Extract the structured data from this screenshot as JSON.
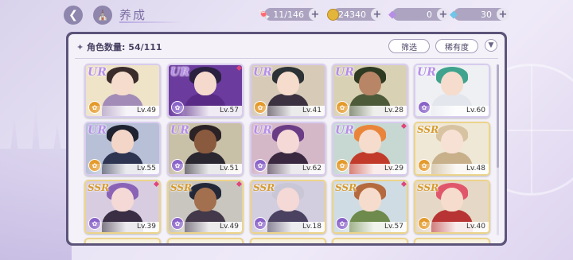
{
  "header": {
    "title": "养成",
    "resources": [
      {
        "name": "stamina",
        "icon": "candy-icon",
        "value": "11/146",
        "color": "#e2536b"
      },
      {
        "name": "gold",
        "icon": "coin-icon",
        "value": "24340",
        "color": "#e3b53b"
      },
      {
        "name": "diamond",
        "icon": "diamond-icon",
        "value": "0",
        "color": "#b78de6"
      },
      {
        "name": "crystal",
        "icon": "crystal-icon",
        "value": "30",
        "color": "#6fc6e8"
      }
    ]
  },
  "panel": {
    "count_label": "角色数量:",
    "count_value": "54/111",
    "filter_label": "筛选",
    "rarity_label": "稀有度"
  },
  "cards": [
    {
      "rarity": "UR",
      "level": "Lv.49",
      "attr_color": "#e49a2b",
      "hair": "#3b2c2c",
      "face": "#f6dccc",
      "body": "#a28bb6",
      "bg": "#efe3c8",
      "new": false
    },
    {
      "rarity": "UR",
      "level": "Lv.57",
      "attr_color": "#8a63c8",
      "hair": "#2a2140",
      "face": "#f4d9cc",
      "body": "#5a2b86",
      "bg": "#6b3b9e",
      "new": true
    },
    {
      "rarity": "UR",
      "level": "Lv.41",
      "attr_color": "#e49a2b",
      "hair": "#2c3236",
      "face": "#f6dccc",
      "body": "#3b3140",
      "bg": "#d7cbb8",
      "new": false
    },
    {
      "rarity": "UR",
      "level": "Lv.28",
      "attr_color": "#e49a2b",
      "hair": "#2e3a22",
      "face": "#b88566",
      "body": "#4d5a3a",
      "bg": "#d9d1b4",
      "new": false
    },
    {
      "rarity": "UR",
      "level": "Lv.60",
      "attr_color": "#8a63c8",
      "hair": "#3fa38d",
      "face": "#f6dccc",
      "body": "#e3e6ec",
      "bg": "#eef0f3",
      "new": false
    },
    {
      "rarity": "UR",
      "level": "Lv.55",
      "attr_color": "#e49a2b",
      "hair": "#1f2230",
      "face": "#f3d6c7",
      "body": "#2e3550",
      "bg": "#b7c0d6",
      "new": false
    },
    {
      "rarity": "UR",
      "level": "Lv.51",
      "attr_color": "#8a63c8",
      "hair": "#2b2226",
      "face": "#8a5a3f",
      "body": "#2b2730",
      "bg": "#c9c0a8",
      "new": false
    },
    {
      "rarity": "UR",
      "level": "Lv.62",
      "attr_color": "#8a63c8",
      "hair": "#6b3c86",
      "face": "#f4d9d6",
      "body": "#3a2840",
      "bg": "#d5b8c8",
      "new": false
    },
    {
      "rarity": "UR",
      "level": "Lv.29",
      "attr_color": "#e49a2b",
      "hair": "#e9853a",
      "face": "#f6dccc",
      "body": "#c23b2a",
      "bg": "#c7d8d2",
      "new": true
    },
    {
      "rarity": "SSR",
      "level": "Lv.48",
      "attr_color": "#e49a2b",
      "hair": "#d7c3a1",
      "face": "#f7e1d4",
      "body": "#c7b08a",
      "bg": "#efe8d6",
      "new": false
    },
    {
      "rarity": "SSR",
      "level": "Lv.39",
      "attr_color": "#8a63c8",
      "hair": "#8b63b6",
      "face": "#f4d9d6",
      "body": "#3a2e44",
      "bg": "#d8cde0",
      "new": true
    },
    {
      "rarity": "SSR",
      "level": "Lv.49",
      "attr_color": "#8a63c8",
      "hair": "#232838",
      "face": "#a3704f",
      "body": "#43394a",
      "bg": "#c9c6bf",
      "new": true
    },
    {
      "rarity": "SSR",
      "level": "Lv.18",
      "attr_color": "#8a63c8",
      "hair": "#c9c7d6",
      "face": "#f4d9d6",
      "body": "#4a4260",
      "bg": "#d3cde0",
      "new": false
    },
    {
      "rarity": "SSR",
      "level": "Lv.57",
      "attr_color": "#8a63c8",
      "hair": "#b56a3d",
      "face": "#f6dccc",
      "body": "#6e8a4c",
      "bg": "#cfdce3",
      "new": true
    },
    {
      "rarity": "SSR",
      "level": "Lv.40",
      "attr_color": "#e49a2b",
      "hair": "#e0566b",
      "face": "#f6dccc",
      "body": "#b83434",
      "bg": "#e6d8c6",
      "new": false
    }
  ]
}
